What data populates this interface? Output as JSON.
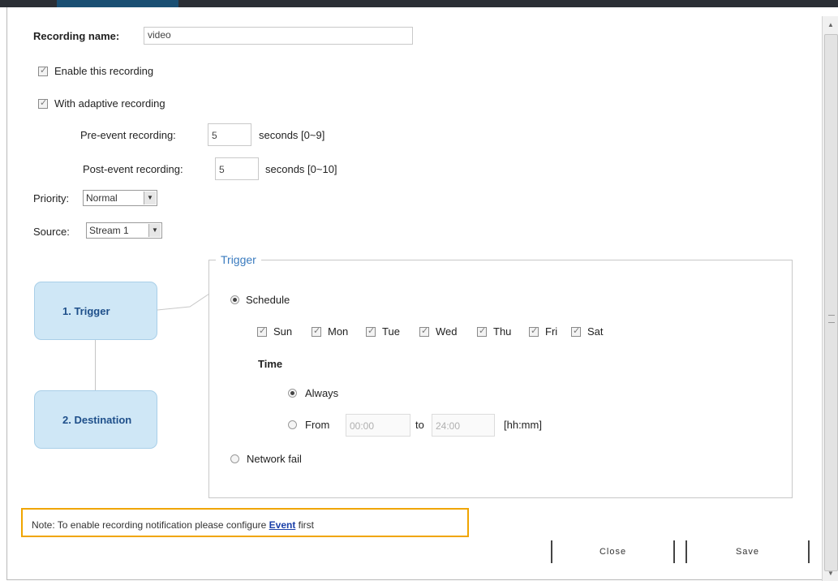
{
  "form": {
    "recording_name_label": "Recording name:",
    "recording_name_value": "video",
    "enable_recording_label": "Enable this recording",
    "adaptive_recording_label": "With adaptive recording",
    "pre_event_label": "Pre-event recording:",
    "pre_event_value": "5",
    "pre_event_unit": "seconds [0~9]",
    "post_event_label": "Post-event recording:",
    "post_event_value": "5",
    "post_event_unit": "seconds [0~10]",
    "priority_label": "Priority:",
    "priority_value": "Normal",
    "source_label": "Source:",
    "source_value": "Stream 1"
  },
  "steps": [
    {
      "label": "1. Trigger"
    },
    {
      "label": "2. Destination"
    }
  ],
  "trigger": {
    "legend": "Trigger",
    "schedule_label": "Schedule",
    "days": [
      "Sun",
      "Mon",
      "Tue",
      "Wed",
      "Thu",
      "Fri",
      "Sat"
    ],
    "time_label": "Time",
    "always_label": "Always",
    "from_label": "From",
    "from_value": "00:00",
    "to_label": "to",
    "to_value": "24:00",
    "time_format": "[hh:mm]",
    "network_fail_label": "Network fail"
  },
  "note": {
    "prefix": "Note: To enable recording notification please configure ",
    "link": "Event",
    "suffix": " first"
  },
  "buttons": {
    "close": "Close",
    "save": "Save"
  }
}
